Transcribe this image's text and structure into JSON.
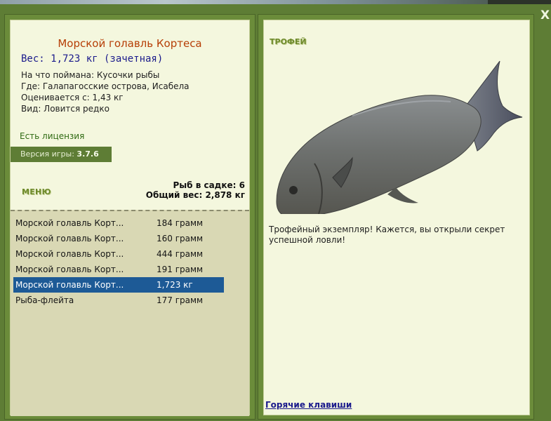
{
  "window": {
    "close_label": "X"
  },
  "fish": {
    "title": "Морской голавль Кортеса",
    "weight_line": "Вес: 1,723 кг (зачетная)",
    "caught_on": "На что поймана: Кусочки рыбы",
    "location": "Где: Галапагосские острова, Исабела",
    "value": "Оценивается с: 1,43 кг",
    "rarity": "Вид: Ловится редко"
  },
  "license_label": "Есть лицензия",
  "version": {
    "label": "Версия игры:",
    "value": "3.7.6"
  },
  "menu_label": "МЕНЮ",
  "keepnet": {
    "count_label": "Рыб в садке: 6",
    "total_label": "Общий вес: 2,878 кг"
  },
  "catch_list": [
    {
      "name": "Морской голавль Корт...",
      "weight": "184 грамм",
      "selected": false
    },
    {
      "name": "Морской голавль Корт...",
      "weight": "160 грамм",
      "selected": false
    },
    {
      "name": "Морской голавль Корт...",
      "weight": "444 грамм",
      "selected": false
    },
    {
      "name": "Морской голавль Корт...",
      "weight": "191 грамм",
      "selected": false
    },
    {
      "name": "Морской голавль Корт...",
      "weight": "1,723 кг",
      "selected": true
    },
    {
      "name": "Рыба-флейта",
      "weight": "177 грамм",
      "selected": false
    }
  ],
  "trophy": {
    "label": "ТРОФЕЙ",
    "text": "Трофейный экземпляр! Кажется, вы открыли секрет успешной ловли!"
  },
  "hotkeys_label": "Горячие клавиши",
  "colors": {
    "frame_green": "#6b8c3a",
    "panel_bg": "#f4f7de",
    "title_orange": "#b63e06",
    "weight_blue": "#1b1b8c",
    "selection_blue": "#1d5a96",
    "list_bg": "#d9d8b4"
  }
}
